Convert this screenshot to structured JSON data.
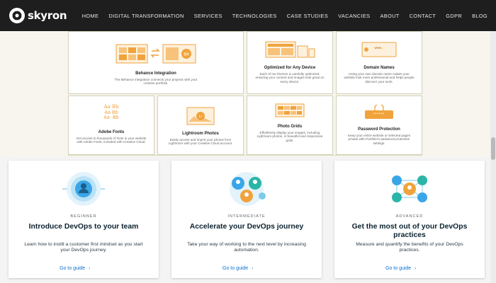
{
  "brand": {
    "name": "skyron"
  },
  "nav": {
    "items": [
      "HOME",
      "DIGITAL TRANSFORMATION",
      "SERVICES",
      "TECHNOLOGIES",
      "CASE STUDIES",
      "VACANCIES",
      "ABOUT",
      "CONTACT",
      "GDPR",
      "BLOG"
    ]
  },
  "features": {
    "cards": [
      {
        "title": "Behance Integration",
        "description": "The Behance integration connects your projects with your creative portfolio."
      },
      {
        "title": "Optimized for Any Device",
        "description": "Each of our themes is carefully optimized, ensuring your content and images look great on every device."
      },
      {
        "title": "Domain Names",
        "description": "Using your own domain name makes your website look more professional and helps people discover your work.",
        "badge": "www."
      },
      {
        "title": "Adobe Fonts",
        "description": "Get access to thousands of fonts in your website with Adobe Fonts, included with Creative Cloud.",
        "font_sample": [
          "Aa Bb",
          "Aa Bb",
          "Aa Bb"
        ]
      },
      {
        "title": "Lightroom Photos",
        "description": "Easily access and import your photos from Lightroom with your Creative Cloud account."
      },
      {
        "title": "Photo Grids",
        "description": "Effortlessly display your images, including Lightroom photos, in beautiful and responsive grids."
      },
      {
        "title": "Password Protection",
        "description": "Keep your entire website or selected pages private with Portfolio's password protection settings.",
        "badge": "••••••"
      }
    ]
  },
  "guides": {
    "cards": [
      {
        "level": "BEGINNER",
        "title": "Introduce DevOps to your team",
        "description": "Learn how to instill a customer first mindset as you start your DevOps journey.",
        "link": "Go to guide"
      },
      {
        "level": "INTERMEDIATE",
        "title": "Accelerate your DevOps journey",
        "description": "Take your way of working to the next level by increasing automation.",
        "link": "Go to guide"
      },
      {
        "level": "ADVANCED",
        "title": "Get the most out of your DevOps practices",
        "description": "Measure and quantify the benefits of your DevOps practices.",
        "link": "Go to guide"
      }
    ],
    "link_arrow": "›"
  },
  "colors": {
    "topbar": "#1e1e1e",
    "accent_link": "#0a6ed1",
    "illustration_orange": "#f0a33c",
    "illustration_blue": "#3aa6e8",
    "heading_dark": "#0b2230"
  }
}
